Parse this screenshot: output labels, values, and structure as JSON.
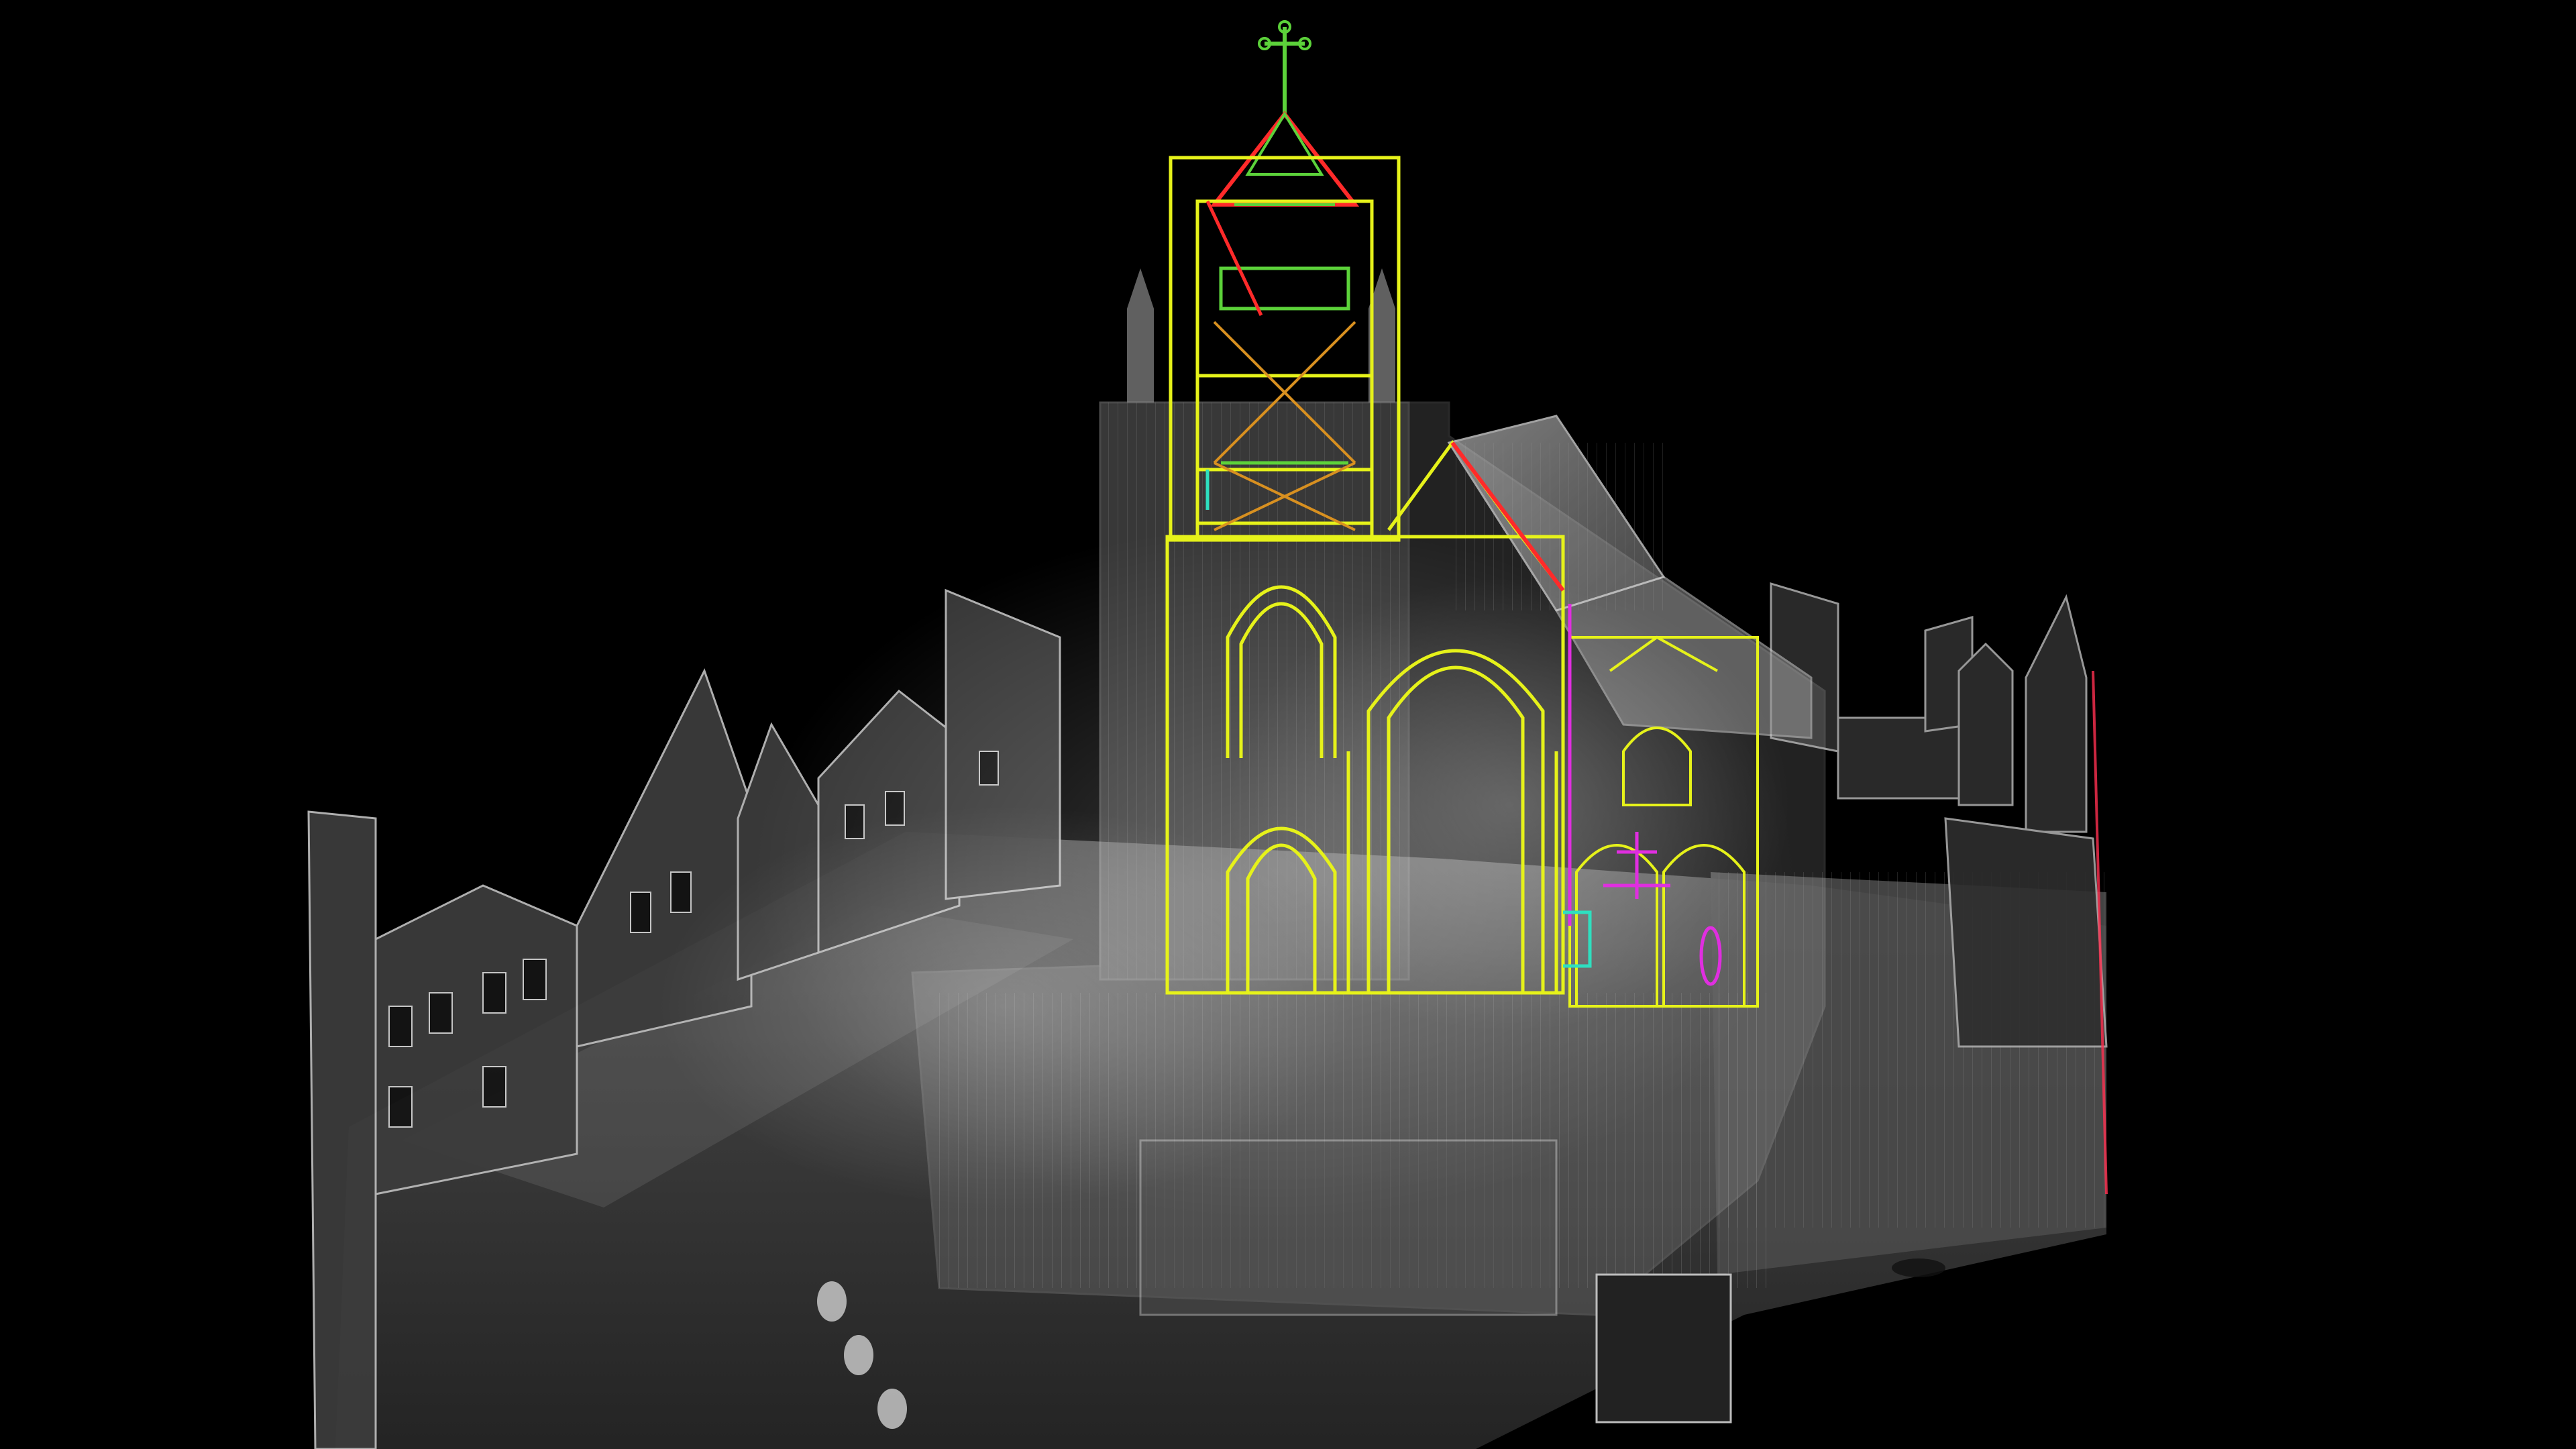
{
  "scene": {
    "subject": "church",
    "view": "point-cloud",
    "background_color": "#000000",
    "point_cloud_color": "#d8d8d8",
    "overlay_colors": {
      "primary_lines": "#e6f21a",
      "roof_lines": "#ff2a2a",
      "accent_green": "#5cd23a",
      "accent_magenta": "#e02ee0",
      "accent_cyan": "#2ee0c0",
      "accent_orange": "#d89020"
    }
  }
}
